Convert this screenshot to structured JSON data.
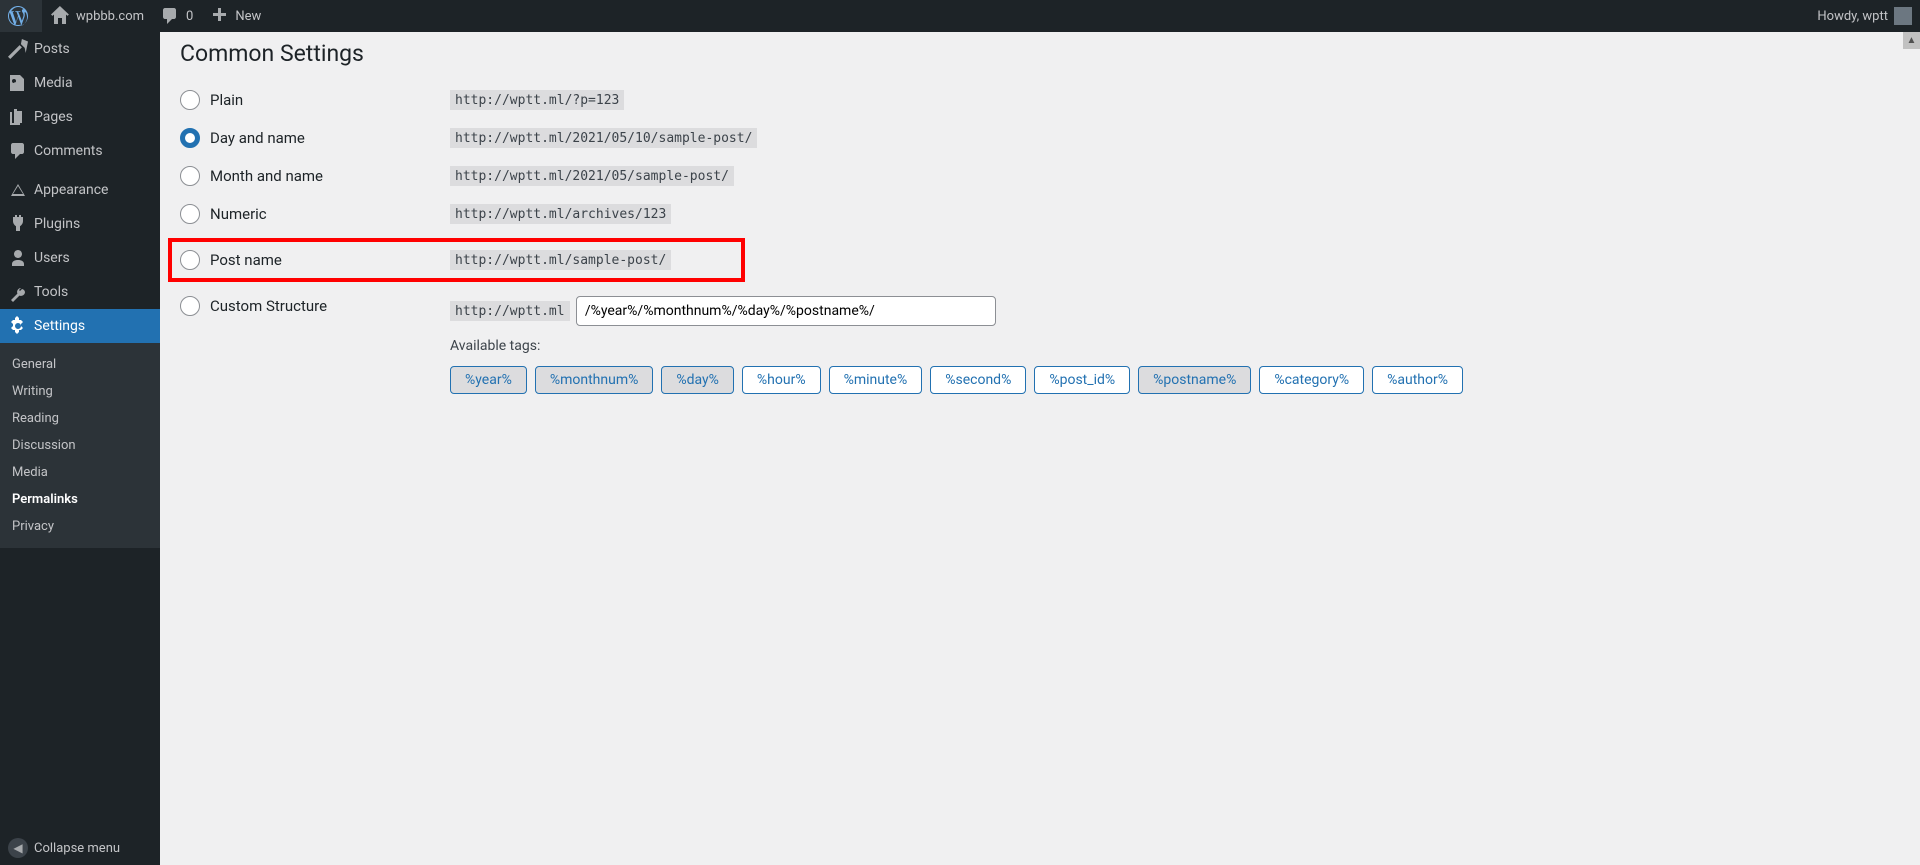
{
  "adminbar": {
    "site_name": "wpbbb.com",
    "comments": "0",
    "new": "New",
    "greeting": "Howdy, wptt"
  },
  "adminmenu": {
    "posts": "Posts",
    "media": "Media",
    "pages": "Pages",
    "comments": "Comments",
    "appearance": "Appearance",
    "plugins": "Plugins",
    "users": "Users",
    "tools": "Tools",
    "settings": "Settings",
    "submenu": {
      "general": "General",
      "writing": "Writing",
      "reading": "Reading",
      "discussion": "Discussion",
      "media": "Media",
      "permalinks": "Permalinks",
      "privacy": "Privacy"
    },
    "collapse": "Collapse menu"
  },
  "page": {
    "section_title": "Common Settings",
    "options": {
      "plain": {
        "label": "Plain",
        "example": "http://wptt.ml/?p=123"
      },
      "day_name": {
        "label": "Day and name",
        "example": "http://wptt.ml/2021/05/10/sample-post/"
      },
      "month_name": {
        "label": "Month and name",
        "example": "http://wptt.ml/2021/05/sample-post/"
      },
      "numeric": {
        "label": "Numeric",
        "example": "http://wptt.ml/archives/123"
      },
      "post_name": {
        "label": "Post name",
        "example": "http://wptt.ml/sample-post/"
      },
      "custom": {
        "label": "Custom Structure",
        "base": "http://wptt.ml",
        "value": "/%year%/%monthnum%/%day%/%postname%/"
      }
    },
    "available_tags_label": "Available tags:",
    "tags": {
      "year": "%year%",
      "monthnum": "%monthnum%",
      "day": "%day%",
      "hour": "%hour%",
      "minute": "%minute%",
      "second": "%second%",
      "post_id": "%post_id%",
      "postname": "%postname%",
      "category": "%category%",
      "author": "%author%"
    }
  }
}
